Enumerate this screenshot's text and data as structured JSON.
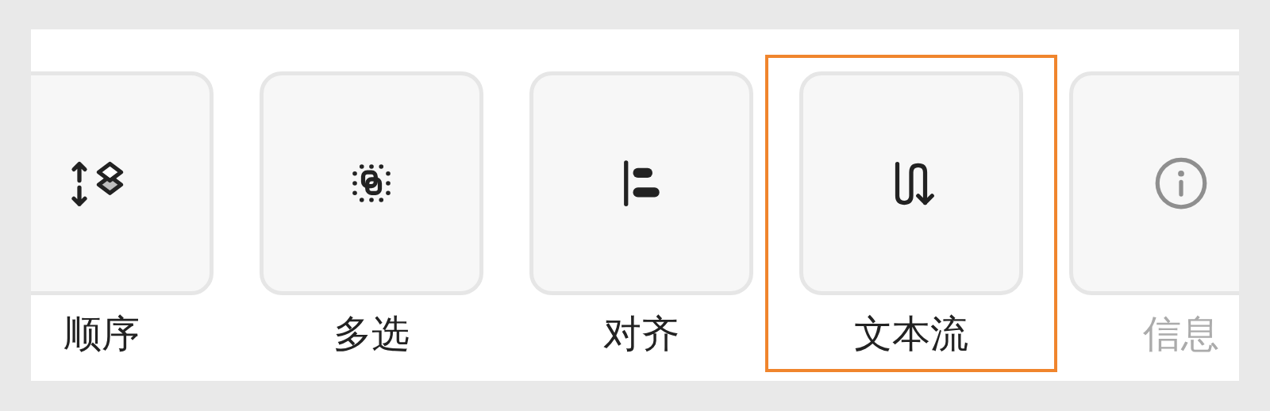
{
  "items": [
    {
      "label": "顺序",
      "selected": false,
      "disabled": false
    },
    {
      "label": "多选",
      "selected": false,
      "disabled": false
    },
    {
      "label": "对齐",
      "selected": false,
      "disabled": false
    },
    {
      "label": "文本流",
      "selected": true,
      "disabled": false
    },
    {
      "label": "信息",
      "selected": false,
      "disabled": true
    }
  ]
}
